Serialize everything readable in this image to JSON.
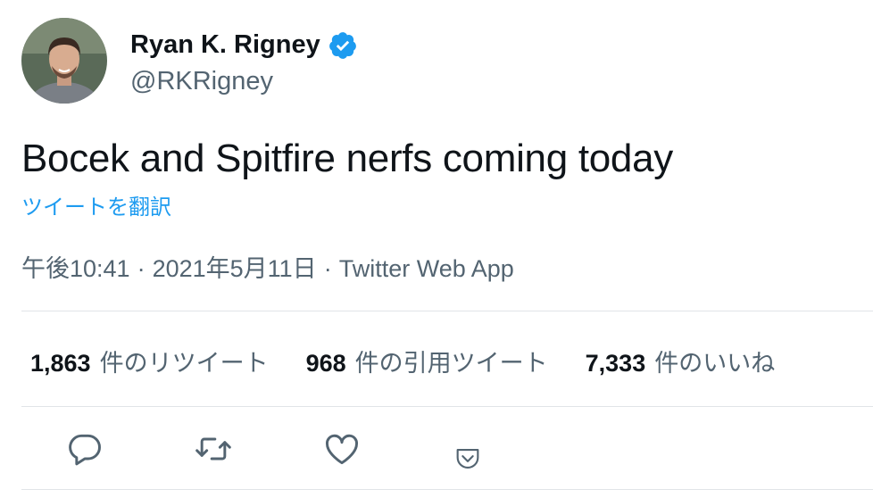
{
  "author": {
    "display_name": "Ryan K. Rigney",
    "handle": "@RKRigney",
    "verified": true,
    "avatar_icon": "profile-photo",
    "verified_icon": "verified-badge-icon"
  },
  "tweet": {
    "text": "Bocek and Spitfire nerfs coming today",
    "translate_label": "ツイートを翻訳",
    "time": "午後10:41",
    "separator": "·",
    "date": "2021年5月11日",
    "source": "Twitter Web App"
  },
  "stats": [
    {
      "count": "1,863",
      "label": "件のリツイート"
    },
    {
      "count": "968",
      "label": "件の引用ツイート"
    },
    {
      "count": "7,333",
      "label": "件のいいね"
    }
  ],
  "actions": [
    {
      "name": "reply",
      "icon": "reply-icon"
    },
    {
      "name": "retweet",
      "icon": "retweet-icon"
    },
    {
      "name": "like",
      "icon": "heart-icon"
    },
    {
      "name": "share",
      "icon": "pocket-icon"
    }
  ],
  "colors": {
    "text": "#0f1419",
    "secondary": "#536471",
    "accent": "#1d9bf0",
    "divider": "#e1e4e8"
  }
}
